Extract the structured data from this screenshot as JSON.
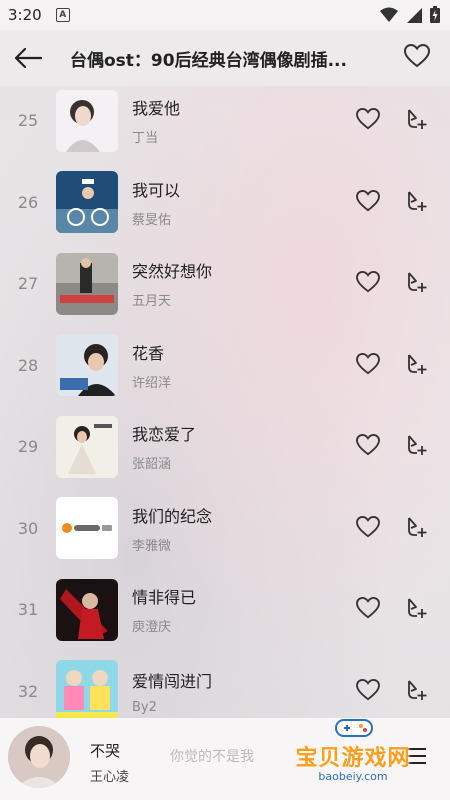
{
  "status": {
    "time": "3:20",
    "notif_letter": "A"
  },
  "header": {
    "title": "台偶ost：90后经典台湾偶像剧插..."
  },
  "songs": [
    {
      "index": "25",
      "title": "我爱他",
      "artist": "丁当"
    },
    {
      "index": "26",
      "title": "我可以",
      "artist": "蔡旻佑"
    },
    {
      "index": "27",
      "title": "突然好想你",
      "artist": "五月天"
    },
    {
      "index": "28",
      "title": "花香",
      "artist": "许绍洋"
    },
    {
      "index": "29",
      "title": "我恋爱了",
      "artist": "张韶涵"
    },
    {
      "index": "30",
      "title": "我们的纪念",
      "artist": "李雅微"
    },
    {
      "index": "31",
      "title": "情非得已",
      "artist": "庾澄庆"
    },
    {
      "index": "32",
      "title": "爱情闯进门",
      "artist": "By2"
    }
  ],
  "player": {
    "title": "不哭",
    "artist": "王心凌",
    "lyric": "你觉的不是我"
  },
  "watermark": {
    "text": "宝贝游戏网",
    "url": "baobeiy.com"
  },
  "colors": {
    "accent_orange": "#ff9c1a",
    "muted_text": "#8a8a8a"
  }
}
